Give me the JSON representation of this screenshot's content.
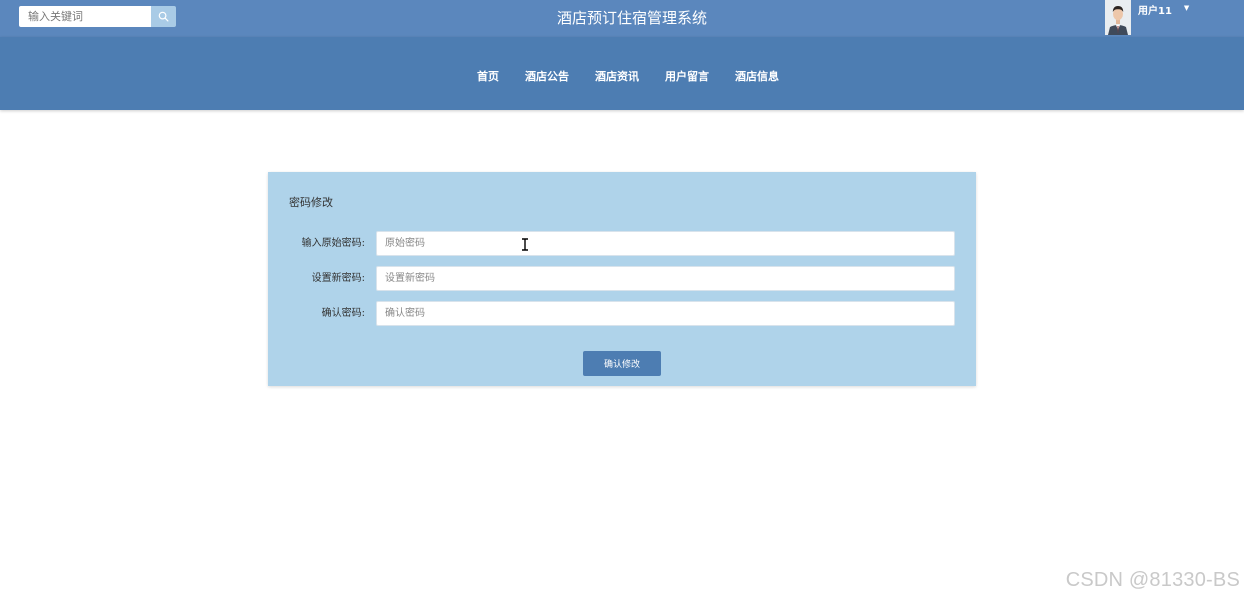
{
  "header": {
    "search_placeholder": "输入关键词",
    "site_title": "酒店预订住宿管理系统",
    "user_name": "用户11",
    "search_icon": "search-icon",
    "caret_icon": "caret-down-icon"
  },
  "nav": {
    "items": [
      {
        "label": "首页"
      },
      {
        "label": "酒店公告"
      },
      {
        "label": "酒店资讯"
      },
      {
        "label": "用户留言"
      },
      {
        "label": "酒店信息"
      }
    ]
  },
  "form": {
    "title": "密码修改",
    "fields": [
      {
        "label": "输入原始密码:",
        "placeholder": "原始密码",
        "value": ""
      },
      {
        "label": "设置新密码:",
        "placeholder": "设置新密码",
        "value": ""
      },
      {
        "label": "确认密码:",
        "placeholder": "确认密码",
        "value": ""
      }
    ],
    "submit_label": "确认修改"
  },
  "watermark": "CSDN @81330-BS",
  "colors": {
    "topbar": "#5b87bd",
    "navbar": "#4d7db2",
    "panel": "#afd3ea",
    "accent": "#4d7db2"
  }
}
